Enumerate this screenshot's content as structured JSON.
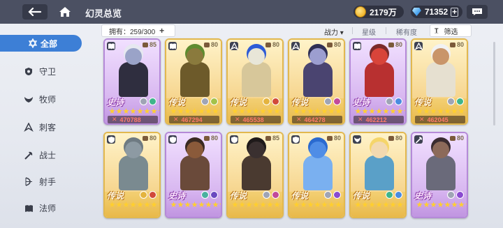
{
  "topbar": {
    "title": "幻灵总览",
    "gold": "2179万",
    "gems": "71352",
    "plus": "+"
  },
  "sidebar": {
    "items": [
      {
        "label": "全部",
        "icon": "star-of-david-icon",
        "active": true
      },
      {
        "label": "守卫",
        "icon": "shield-icon"
      },
      {
        "label": "牧师",
        "icon": "wings-icon"
      },
      {
        "label": "刺客",
        "icon": "dagger-icon"
      },
      {
        "label": "战士",
        "icon": "axe-icon"
      },
      {
        "label": "射手",
        "icon": "bow-icon"
      },
      {
        "label": "法师",
        "icon": "book-icon"
      }
    ]
  },
  "filterbar": {
    "owned": "拥有：259/300",
    "plus": "+",
    "power": "战力",
    "power_arrow": "▾",
    "star": "星级",
    "rarity": "稀有度",
    "filter": "筛选",
    "filter_icon": "T̲"
  },
  "colors": {
    "topbar": "#4b5062",
    "accent": "#3d7fd6",
    "legend_border": "#e2b84f",
    "epic_border": "#b58ad8"
  },
  "cards": [
    {
      "rarity_label": "史诗",
      "rarity": "epic",
      "level": "85",
      "stars": 10,
      "power": "470788",
      "class": "book",
      "skin": "#9aa3c8",
      "hair": "#e6e8f0",
      "outfit": "#2f2e3f",
      "skills": [
        "#9fa4b5",
        "#3fb58a"
      ]
    },
    {
      "rarity_label": "传说",
      "rarity": "legend",
      "level": "80",
      "stars": 10,
      "power": "467294",
      "class": "book",
      "skin": "#8a7a3d",
      "hair": "#5e8c2f",
      "outfit": "#6d5a2a",
      "skills": [
        "#9fa4b5",
        "#a3c24a"
      ]
    },
    {
      "rarity_label": "传说",
      "rarity": "legend",
      "level": "80",
      "stars": 10,
      "power": "465538",
      "class": "dagger",
      "skin": "#e8e6d8",
      "hair": "#2e5bd6",
      "outfit": "#d7c79a",
      "skills": [
        "#e4b43f",
        "#d14a3a"
      ]
    },
    {
      "rarity_label": "传说",
      "rarity": "legend",
      "level": "80",
      "stars": 10,
      "power": "464278",
      "class": "dagger",
      "skin": "#9c9ed0",
      "hair": "#2f2f55",
      "outfit": "#4a4470",
      "skills": [
        "#9fa4b5",
        "#c24a9a"
      ]
    },
    {
      "rarity_label": "史诗",
      "rarity": "epic",
      "level": "80",
      "stars": 10,
      "power": "462212",
      "class": "book",
      "skin": "#d8443a",
      "hair": "#7a2a2a",
      "outfit": "#b83030",
      "skills": [
        "#9fa4b5",
        "#4a8be0"
      ]
    },
    {
      "rarity_label": "传说",
      "rarity": "legend",
      "level": "80",
      "stars": 10,
      "power": "462045",
      "class": "dagger",
      "skin": "#c9956a",
      "hair": "#f2f2f2",
      "outfit": "#e6e0d0",
      "skills": [
        "#9fa4b5",
        "#3fb58a"
      ]
    },
    {
      "rarity_label": "传说",
      "rarity": "legend",
      "level": "80",
      "stars": 10,
      "power": "",
      "class": "shield",
      "skin": "#8d9aa3",
      "hair": "#6e7a82",
      "outfit": "#7a8a90",
      "skills": [
        "#e4b43f",
        "#d14a3a"
      ]
    },
    {
      "rarity_label": "史诗",
      "rarity": "epic",
      "level": "80",
      "stars": 10,
      "power": "",
      "class": "shield",
      "skin": "#8a5a3a",
      "hair": "#3a2a22",
      "outfit": "#6a4a3a",
      "skills": [
        "#4ab0a0",
        "#6a4ac0"
      ]
    },
    {
      "rarity_label": "传说",
      "rarity": "legend",
      "level": "85",
      "stars": 10,
      "power": "",
      "class": "shield",
      "skin": "#3a3030",
      "hair": "#1f1a1a",
      "outfit": "#4a3a30",
      "skills": [
        "#9fa4b5",
        "#c24a9a"
      ]
    },
    {
      "rarity_label": "传说",
      "rarity": "legend",
      "level": "80",
      "stars": 10,
      "power": "",
      "class": "shield",
      "skin": "#4f8de6",
      "hair": "#2a6ad0",
      "outfit": "#7ab0f0",
      "skills": [
        "#9fa4b5",
        "#8a4ad0"
      ]
    },
    {
      "rarity_label": "传说",
      "rarity": "legend",
      "level": "80",
      "stars": 10,
      "power": "",
      "class": "wings",
      "skin": "#f2d9b0",
      "hair": "#f5d56a",
      "outfit": "#5aa0c8",
      "skills": [
        "#3fb58a",
        "#4a8be0"
      ]
    },
    {
      "rarity_label": "史诗",
      "rarity": "epic",
      "level": "80",
      "stars": 10,
      "power": "",
      "class": "axe",
      "skin": "#8c6a5a",
      "hair": "#3a2c30",
      "outfit": "#6a6a7a",
      "skills": [
        "#9fa4b5",
        "#8a4ad0"
      ]
    }
  ]
}
